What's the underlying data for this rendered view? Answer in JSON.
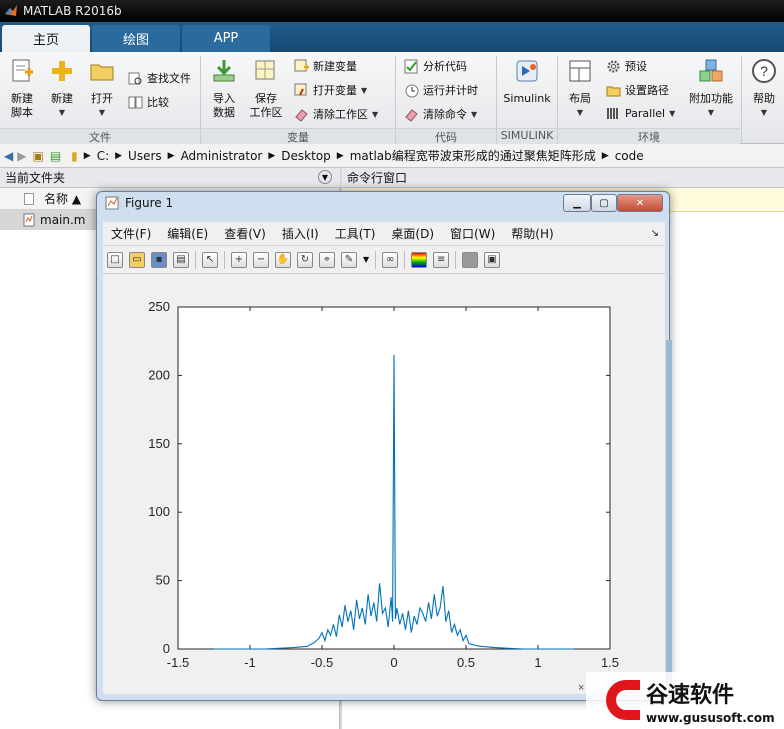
{
  "app": {
    "title": "MATLAB R2016b"
  },
  "tabs": [
    {
      "label": "主页"
    },
    {
      "label": "绘图"
    },
    {
      "label": "APP"
    }
  ],
  "ribbon": {
    "new_script": "新建\n脚本",
    "new": "新建",
    "open": "打开",
    "find_files": "查找文件",
    "compare": "比较",
    "group_file": "文件",
    "import_data": "导入\n数据",
    "save_workspace": "保存\n工作区",
    "new_variable": "新建变量",
    "open_variable": "打开变量",
    "clear_workspace": "清除工作区",
    "group_variable": "变量",
    "analyze_code": "分析代码",
    "run_time": "运行并计时",
    "clear_commands": "清除命令",
    "group_code": "代码",
    "simulink": "Simulink",
    "group_simulink": "SIMULINK",
    "layout": "布局",
    "preferences": "预设",
    "set_path": "设置路径",
    "parallel": "Parallel",
    "group_env": "环境",
    "addons": "附加功能",
    "help": "帮助"
  },
  "address": {
    "parts": [
      "C:",
      "Users",
      "Administrator",
      "Desktop",
      "matlab编程宽带波束形成的通过聚焦矩阵形成",
      "code"
    ]
  },
  "left_panel": {
    "title": "当前文件夹",
    "col_name": "名称 ▲",
    "files": [
      {
        "name": "main.m"
      }
    ]
  },
  "cmd_panel": {
    "title": "命令行窗口"
  },
  "figure": {
    "title": "Figure 1",
    "menu": [
      "文件(F)",
      "编辑(E)",
      "查看(V)",
      "插入(I)",
      "工具(T)",
      "桌面(D)",
      "窗口(W)",
      "帮助(H)"
    ],
    "axis_exponent": "×"
  },
  "chart_data": {
    "type": "line",
    "title": "",
    "xlabel": "",
    "ylabel": "",
    "xlim": [
      -1.5,
      1.5
    ],
    "ylim": [
      0,
      250
    ],
    "xticks": [
      -1.5,
      -1,
      -0.5,
      0,
      0.5,
      1,
      1.5
    ],
    "yticks": [
      0,
      50,
      100,
      150,
      200,
      250
    ],
    "grid": false,
    "series": [
      {
        "color": "#0072bd",
        "x": [
          -1.25,
          -0.9,
          -0.7,
          -0.6,
          -0.55,
          -0.52,
          -0.5,
          -0.48,
          -0.46,
          -0.44,
          -0.42,
          -0.4,
          -0.38,
          -0.36,
          -0.34,
          -0.32,
          -0.3,
          -0.28,
          -0.26,
          -0.24,
          -0.22,
          -0.2,
          -0.18,
          -0.16,
          -0.14,
          -0.12,
          -0.1,
          -0.08,
          -0.06,
          -0.04,
          -0.02,
          -0.01,
          0,
          0.01,
          0.02,
          0.04,
          0.06,
          0.08,
          0.1,
          0.12,
          0.14,
          0.16,
          0.18,
          0.2,
          0.22,
          0.24,
          0.26,
          0.28,
          0.3,
          0.32,
          0.34,
          0.36,
          0.38,
          0.4,
          0.42,
          0.44,
          0.46,
          0.48,
          0.5,
          0.52,
          0.55,
          0.6,
          0.7,
          0.9,
          1.25
        ],
        "y": [
          0,
          0,
          1,
          2,
          5,
          8,
          12,
          6,
          14,
          10,
          18,
          9,
          25,
          16,
          32,
          20,
          28,
          14,
          36,
          22,
          30,
          18,
          40,
          24,
          34,
          20,
          48,
          26,
          30,
          16,
          38,
          20,
          215,
          22,
          30,
          18,
          26,
          14,
          28,
          12,
          24,
          18,
          30,
          26,
          20,
          34,
          22,
          40,
          24,
          30,
          46,
          20,
          28,
          12,
          18,
          10,
          14,
          6,
          10,
          4,
          3,
          2,
          1,
          0,
          0
        ]
      }
    ]
  }
}
